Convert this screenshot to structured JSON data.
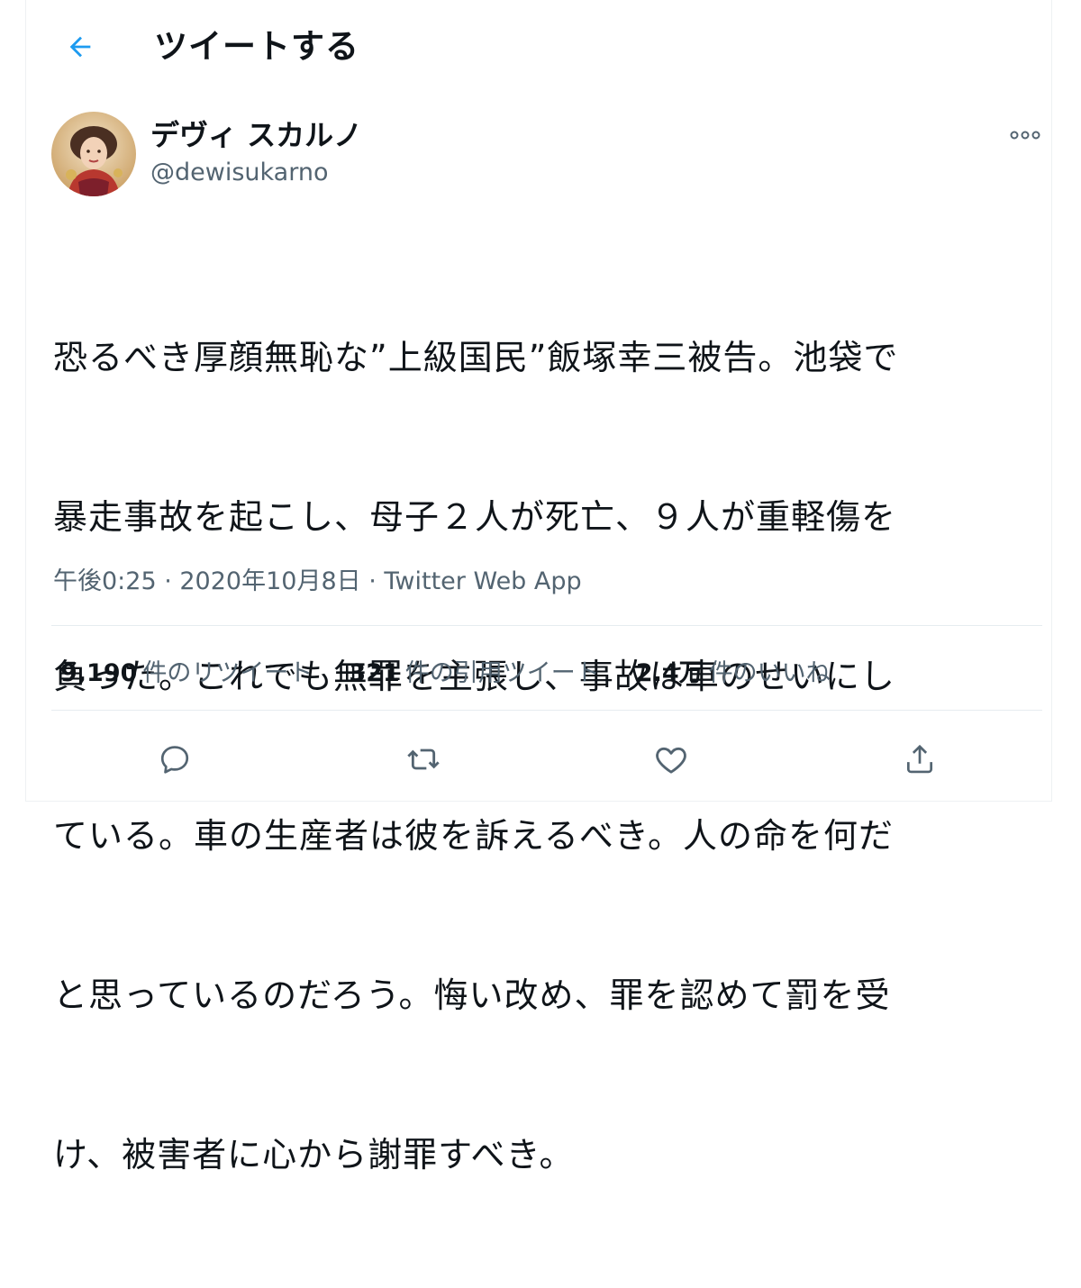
{
  "header": {
    "title": "ツイートする",
    "back_icon": "arrow-left-icon"
  },
  "author": {
    "display_name": "デヴィ スカルノ",
    "handle": "@dewisukarno"
  },
  "tweet": {
    "lines": [
      "恐るべき厚顔無恥な”上級国民”飯塚幸三被告。池袋で",
      "暴走事故を起こし、母子２人が死亡、９人が重軽傷を",
      "負った。これでも無罪を主張し、事故は車のせいにし",
      "ている。車の生産者は彼を訴えるべき。人の命を何だ",
      "と思っているのだろう。悔い改め、罪を認めて罰を受",
      "け、被害者に心から謝罪すべき。"
    ],
    "meta": "午後0:25 · 2020年10月8日 · Twitter Web App"
  },
  "stats": {
    "retweets": {
      "count": "9,190",
      "label": "件のリツイート"
    },
    "quotes": {
      "count": "321",
      "label": "件の引用ツイート"
    },
    "likes": {
      "count": "2.4万",
      "label": "件のいいね"
    }
  },
  "actions": {
    "icons": [
      "reply-icon",
      "retweet-icon",
      "like-icon",
      "share-icon"
    ]
  },
  "colors": {
    "accent": "#1d9bf0",
    "text": "#0f1419",
    "secondary": "#536471",
    "border": "#e6ecf0"
  }
}
